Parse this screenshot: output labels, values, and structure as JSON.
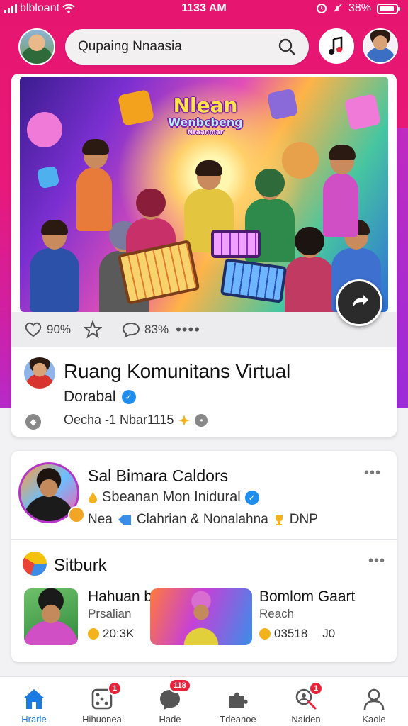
{
  "status_bar": {
    "carrier": "blbloant",
    "time": "1133 AM",
    "battery": "38%"
  },
  "header": {
    "search_text": "Qupaing Nnaasia"
  },
  "hero": {
    "title_line1": "Nlean",
    "title_line2": "Wenbcbeng",
    "title_line3": "Nraanmar"
  },
  "post_stats": {
    "likes": "90%",
    "comments": "83%",
    "more": "••••"
  },
  "post": {
    "title": "Ruang Komunitans Virtual",
    "author": "Dorabal",
    "meta": "Oecha -1 Nbar1115",
    "verified_icon": "✓"
  },
  "card2": {
    "name": "Sal Bimara Caldors",
    "subtitle": "Sbeanan Mon Inidural",
    "subtitle2_a": "Nea",
    "subtitle2_b": "Clahrian & Nonalahna",
    "subtitle2_c": "DNP",
    "more": "•••",
    "section_title": "Sitburk",
    "section_more": "•••",
    "items": [
      {
        "title": "Hahuan b",
        "sub": "Prsalian",
        "stats": "20:3K"
      },
      {
        "title": "Bomlom Gaart",
        "sub": "Reach",
        "stats": "03518",
        "extra": "J0"
      }
    ]
  },
  "bottom_nav": [
    {
      "label": "Hrarle",
      "icon": "home-icon",
      "active": true
    },
    {
      "label": "Hihuonea",
      "icon": "dice-icon",
      "badge": "1"
    },
    {
      "label": "Hade",
      "icon": "chat-bubble-icon",
      "badge": "118"
    },
    {
      "label": "Tdeanoe",
      "icon": "puzzle-icon"
    },
    {
      "label": "Naiden",
      "icon": "search-person-icon",
      "badge": "1"
    },
    {
      "label": "Kaole",
      "icon": "profile-icon"
    }
  ],
  "colors": {
    "accent": "#e8197a",
    "active_nav": "#1d7be0",
    "badge": "#e8243c"
  }
}
